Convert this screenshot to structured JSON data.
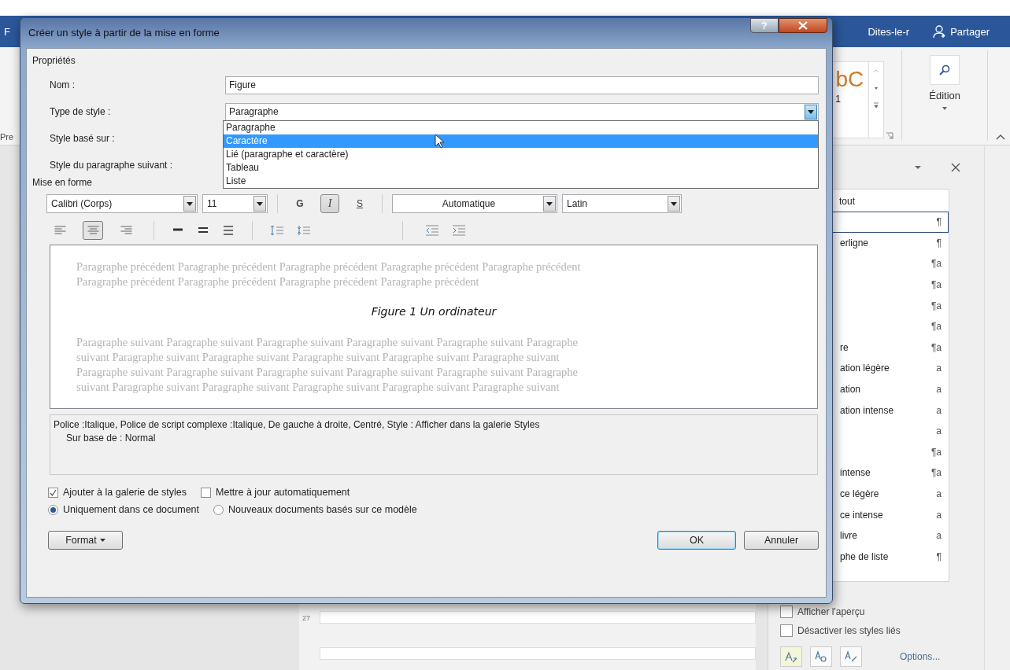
{
  "app": {
    "title_initial": "F",
    "tell_me": "Dites-le-r",
    "share": "Partager",
    "ribbon_left": "Pre",
    "gallery_preview": "bC",
    "gallery_number": "1",
    "edit_label": "Édition",
    "ruler_number": "27"
  },
  "dialog": {
    "title": "Créer un style à partir de la mise en forme",
    "help": "?",
    "properties_label": "Propriétés",
    "name_label": "Nom :",
    "name_value": "Figure",
    "type_label": "Type de style :",
    "type_value": "Paragraphe",
    "type_options": [
      {
        "label": "Paragraphe",
        "selected": false
      },
      {
        "label": "Caractère",
        "selected": true
      },
      {
        "label": "Lié (paragraphe et caractère)",
        "selected": false
      },
      {
        "label": "Tableau",
        "selected": false
      },
      {
        "label": "Liste",
        "selected": false
      }
    ],
    "based_label": "Style basé sur :",
    "next_label": "Style du paragraphe suivant :",
    "format_label": "Mise en forme",
    "font": "Calibri (Corps)",
    "size": "11",
    "format_buttons": [
      {
        "label": "G",
        "kind": "bold",
        "pressed": false
      },
      {
        "label": "I",
        "kind": "italic",
        "pressed": true
      },
      {
        "label": "S",
        "kind": "underline",
        "pressed": false
      }
    ],
    "font_color": "Automatique",
    "script": "Latin",
    "alignment": [
      {
        "kind": "left",
        "pressed": false
      },
      {
        "kind": "center",
        "pressed": true
      },
      {
        "kind": "right",
        "pressed": false
      }
    ],
    "preview": {
      "before": [
        "Paragraphe précédent Paragraphe précédent Paragraphe précédent Paragraphe précédent Paragraphe précédent",
        "Paragraphe précédent Paragraphe précédent Paragraphe précédent Paragraphe précédent"
      ],
      "sample": "Figure 1 Un ordinateur",
      "after": [
        "Paragraphe suivant Paragraphe suivant Paragraphe suivant Paragraphe suivant Paragraphe suivant Paragraphe",
        "suivant Paragraphe suivant Paragraphe suivant Paragraphe suivant Paragraphe suivant Paragraphe suivant",
        "Paragraphe suivant Paragraphe suivant Paragraphe suivant Paragraphe suivant Paragraphe suivant Paragraphe",
        "suivant Paragraphe suivant Paragraphe suivant Paragraphe suivant Paragraphe suivant Paragraphe suivant"
      ]
    },
    "description": [
      "Police :Italique, Police de script complexe :Italique, De gauche à droite, Centré, Style : Afficher dans la galerie Styles",
      "Sur base de : Normal"
    ],
    "checks": [
      {
        "label": "Ajouter à la galerie de styles",
        "checked": true
      },
      {
        "label": "Mettre à jour automatiquement",
        "checked": false
      }
    ],
    "radios": [
      {
        "label": "Uniquement dans ce document",
        "selected": true
      },
      {
        "label": "Nouveaux documents basés sur ce modèle",
        "selected": false
      }
    ],
    "format_button": "Format",
    "ok": "OK",
    "cancel": "Annuler"
  },
  "styles_pane": {
    "clear_label": "tout",
    "items": [
      {
        "mark": "¶",
        "selected": true
      },
      {
        "name": "erligne",
        "mark": "¶",
        "selected": false
      },
      {
        "mark": "¶a",
        "selected": false
      },
      {
        "mark": "¶a",
        "selected": false
      },
      {
        "mark": "¶a",
        "selected": false
      },
      {
        "mark": "¶a",
        "selected": false
      },
      {
        "name": "re",
        "mark": "¶a",
        "selected": false
      },
      {
        "name": "ation légère",
        "mark": "a",
        "selected": false
      },
      {
        "name": "ation",
        "mark": "a",
        "selected": false
      },
      {
        "name": "ation intense",
        "mark": "a",
        "selected": false
      },
      {
        "mark": "a",
        "selected": false
      },
      {
        "mark": "¶a",
        "selected": false
      },
      {
        "name": "intense",
        "mark": "¶a",
        "selected": false
      },
      {
        "name": "ce légère",
        "mark": "a",
        "selected": false
      },
      {
        "name": "ce intense",
        "mark": "a",
        "selected": false
      },
      {
        "name": "livre",
        "mark": "a",
        "selected": false
      },
      {
        "name": "phe de liste",
        "mark": "¶",
        "selected": false
      }
    ],
    "checks": [
      {
        "label": "Afficher l'aperçu",
        "checked": false
      },
      {
        "label": "Désactiver les styles liés",
        "checked": false
      }
    ],
    "options": "Options..."
  }
}
